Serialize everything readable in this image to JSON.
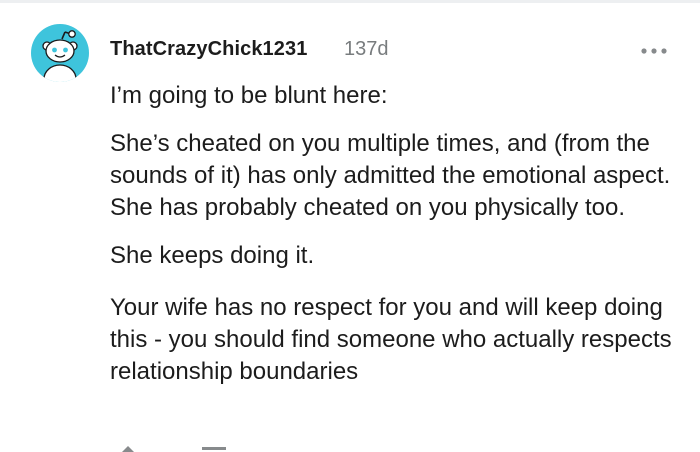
{
  "comment": {
    "author": {
      "username": "ThatCrazyChick1231",
      "avatar_icon": "snoo-avatar-icon",
      "avatar_color": "#3ec4dc"
    },
    "age": "137d",
    "more_icon": "more-options-icon",
    "paragraphs": [
      "I’m going to be blunt here:",
      "She’s cheated on you multiple times, and (from the sounds of it) has only admitted the emotional aspect. She has probably cheated on you physically too.",
      "She keeps doing it.",
      "Your wife has no respect for you and will keep doing this - you should find someone who actually respects relationship boundaries"
    ]
  }
}
